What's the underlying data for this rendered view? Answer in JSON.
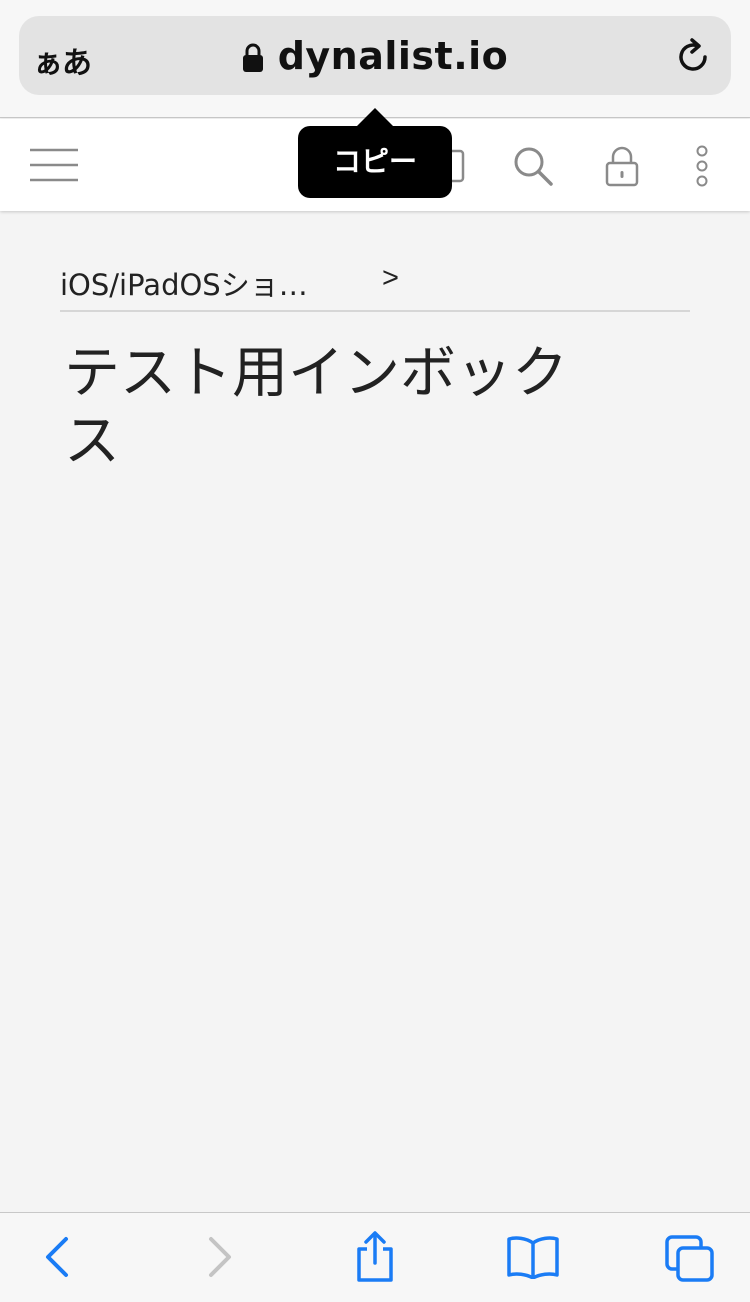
{
  "browser": {
    "text_size_label": "ぁあ",
    "url": "dynalist.io"
  },
  "tooltip": {
    "label": "コピー"
  },
  "breadcrumb": {
    "parent": "iOS/iPadOSショ…",
    "separator": ">"
  },
  "document": {
    "title": "テスト用インボックス"
  },
  "colors": {
    "accent": "#1a7cf5",
    "disabled": "#c4c4c4"
  }
}
